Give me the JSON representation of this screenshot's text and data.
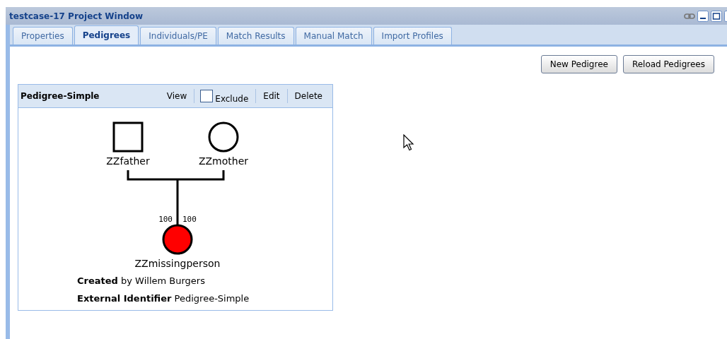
{
  "window": {
    "title": "testcase-17 Project Window"
  },
  "tabs": [
    {
      "label": "Properties",
      "selected": false
    },
    {
      "label": "Pedigrees",
      "selected": true
    },
    {
      "label": "Individuals/PE",
      "selected": false
    },
    {
      "label": "Match Results",
      "selected": false
    },
    {
      "label": "Manual Match",
      "selected": false
    },
    {
      "label": "Import Profiles",
      "selected": false
    }
  ],
  "toolbar": {
    "buttons": [
      "New Pedigree",
      "Reload Pedigrees"
    ]
  },
  "pedigree_card": {
    "title": "Pedigree-Simple",
    "actions": {
      "view": "View",
      "exclude": {
        "label": "Exclude",
        "checked": false
      },
      "edit": "Edit",
      "delete": "Delete"
    },
    "individuals": [
      {
        "kind": "male",
        "name": "ZZfather",
        "affected": false
      },
      {
        "kind": "female",
        "name": "ZZmother",
        "affected": false
      },
      {
        "kind": "female",
        "name": "ZZmissingperson",
        "affected": true
      }
    ],
    "child_labels": [
      "100",
      "100"
    ],
    "details": [
      {
        "label": "Created",
        "value": "by Willem Burgers"
      },
      {
        "label": "External Identifier",
        "value": "Pedigree-Simple"
      }
    ]
  }
}
